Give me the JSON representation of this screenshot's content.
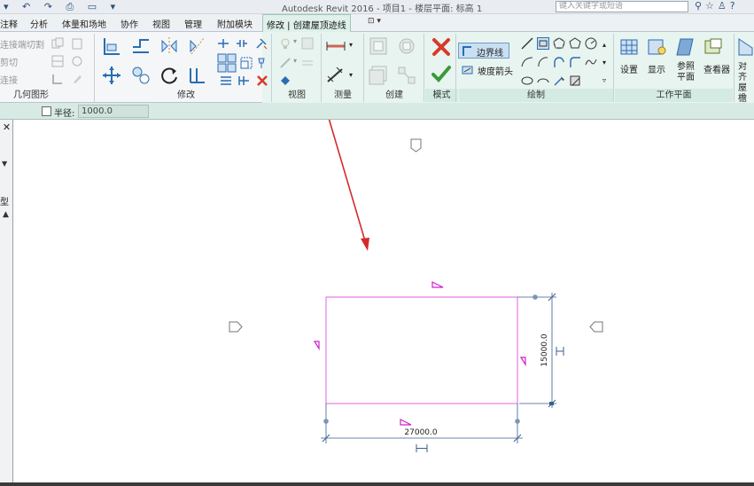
{
  "titlebar": {
    "app_title": "Autodesk Revit 2016 -   项目1 - 楼层平面: 标高 1",
    "search_placeholder": "键入关键字或短语"
  },
  "tabs": [
    "注释",
    "分析",
    "体量和场地",
    "协作",
    "视图",
    "管理",
    "附加模块"
  ],
  "active_tab": "修改 | 创建屋顶迹线",
  "ribbon": {
    "panels": {
      "geometry": "几何图形",
      "modify": "修改",
      "view": "视图",
      "measure": "测量",
      "create": "创建",
      "mode": "模式",
      "draw": "绘制",
      "work_plane": "工作平面"
    },
    "geometry_items": [
      "连接端切割",
      "剪切",
      "连接"
    ],
    "boundary_line": "边界线",
    "slope_arrow": "坡度箭头",
    "work_plane_buttons": [
      "设置",
      "显示",
      "参照平面",
      "查看器"
    ],
    "roof_partial": "对齐屋檐"
  },
  "options_bar": {
    "radius_label": "半径:",
    "radius_value": "1000.0",
    "radius_checked": false
  },
  "left_panel": {
    "type_label": "型"
  },
  "canvas": {
    "dimension_width": "27000.0",
    "dimension_height": "15000.0"
  },
  "colors": {
    "sketch_line": "#e060e0",
    "dimension": "#3a5e8c",
    "annotation_arrow": "#d42a2a",
    "context_tab": "#dff1ea",
    "options_bar": "#d7eae4",
    "finish_green": "#3a9a3a",
    "cancel_red": "#d83a2a"
  }
}
